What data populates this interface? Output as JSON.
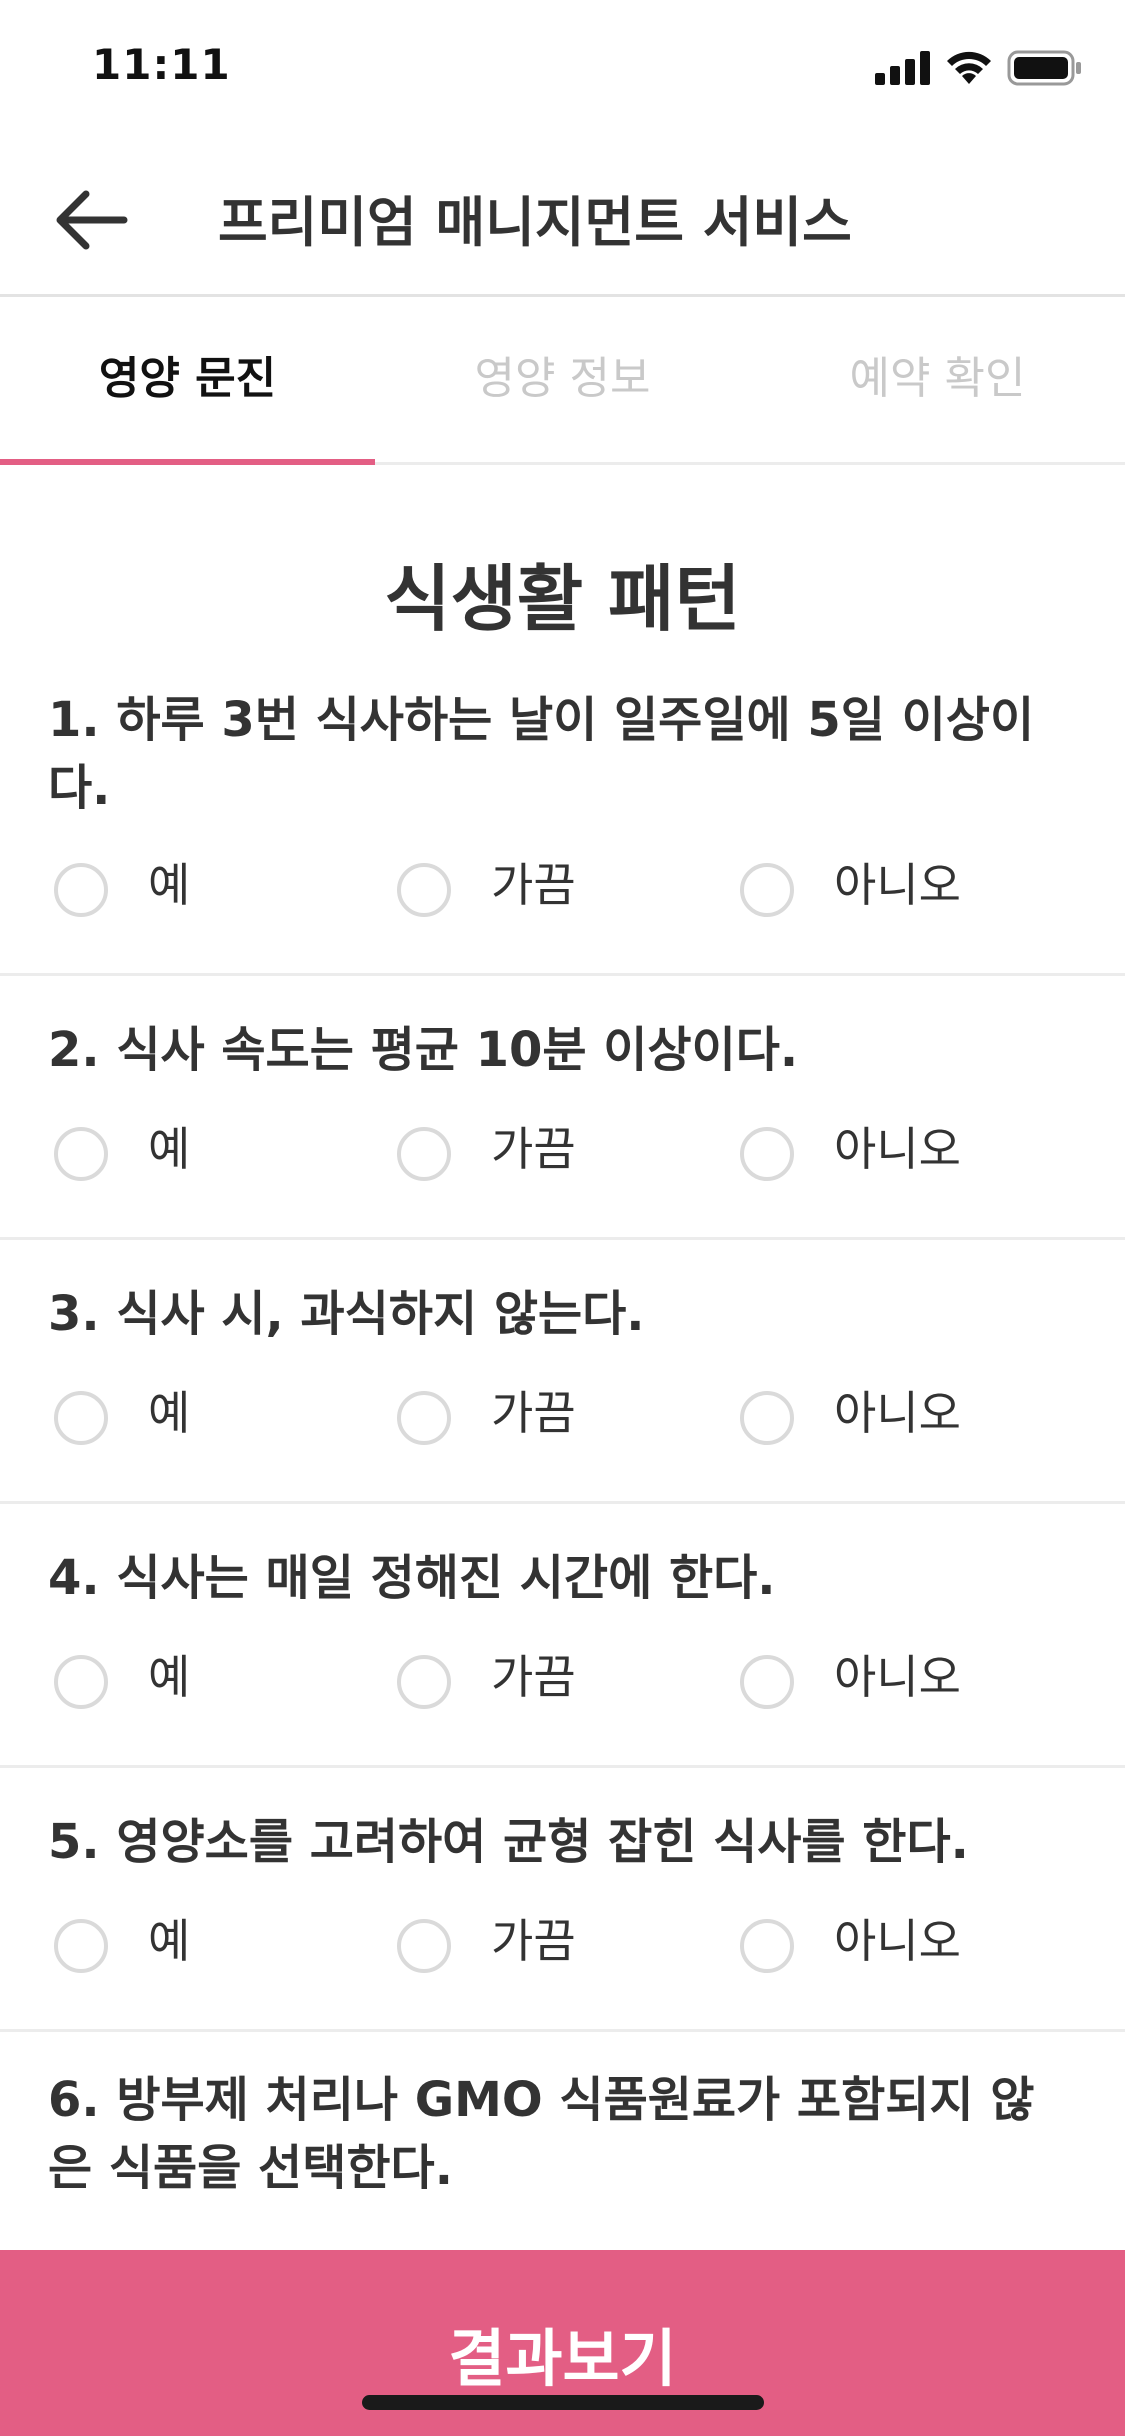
{
  "status_bar": {
    "time": "11:11",
    "icons": [
      "cellular-signal-icon",
      "wifi-icon",
      "battery-icon"
    ]
  },
  "header": {
    "back_icon": "arrow-left-icon",
    "title": "프리미엄 매니지먼트 서비스"
  },
  "tabs": [
    {
      "label": "영양 문진",
      "active": true
    },
    {
      "label": "영양 정보",
      "active": false
    },
    {
      "label": "예약 확인",
      "active": false
    }
  ],
  "section": {
    "title": "식생활 패턴"
  },
  "questions": [
    {
      "text": "1. 하루 3번 식사하는 날이 일주일에 5일 이상이다.",
      "options": [
        "예",
        "가끔",
        "아니오"
      ]
    },
    {
      "text": "2. 식사 속도는 평균 10분 이상이다.",
      "options": [
        "예",
        "가끔",
        "아니오"
      ]
    },
    {
      "text": "3. 식사 시, 과식하지 않는다.",
      "options": [
        "예",
        "가끔",
        "아니오"
      ]
    },
    {
      "text": "4. 식사는 매일 정해진 시간에 한다.",
      "options": [
        "예",
        "가끔",
        "아니오"
      ]
    },
    {
      "text": "5. 영양소를 고려하여 균형 잡힌 식사를 한다.",
      "options": [
        "예",
        "가끔",
        "아니오"
      ]
    },
    {
      "text": "6. 방부제 처리나 GMO 식품원료가 포함되지 않은 식품을 선택한다.",
      "options": []
    }
  ],
  "footer": {
    "submit_label": "결과보기"
  },
  "colors": {
    "accent": "#e35e84",
    "text": "#333333",
    "inactive_tab": "#c9c9c9",
    "radio_border": "#dadada",
    "divider": "#ececec"
  }
}
